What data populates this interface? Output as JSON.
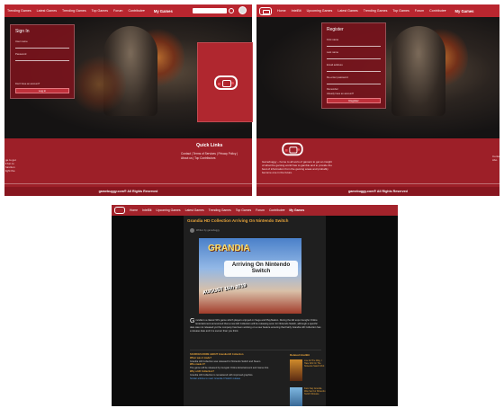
{
  "left_shot": {
    "nav": {
      "items": [
        "Trending Games",
        "Latest Games",
        "Trending Games",
        "Top Games",
        "Forum",
        "Contribute▾"
      ],
      "my_games": "My Games"
    },
    "signin": {
      "title": "Sign In",
      "username_label": "User name",
      "password_label": "Password",
      "forgot": "Don't have an account?",
      "button": "Log in"
    },
    "footer": {
      "quick_links": "Quick Links",
      "links_row1": "Contact | Terms of Services | Privacy Policy |",
      "links_row2": "About us | Top Contributors",
      "left_text": "ge to get\nll fun to\nfunction\nlight the",
      "copyright": "gamebuggy.com® All Rights Reserved"
    }
  },
  "right_shot": {
    "nav": {
      "items": [
        "Home",
        "IntelBit",
        "Upcoming Games",
        "Latest Games",
        "Trending Games",
        "Top Games",
        "Forum",
        "Contribute▾"
      ],
      "my_games": "My Games"
    },
    "register": {
      "title": "Register",
      "fields": [
        "First name",
        "Last name",
        "Email address",
        "Re-enter password"
      ],
      "checkbox": "Remember",
      "small": "Already have an account?",
      "button": "Register"
    },
    "footer": {
      "about": "Gamebuggy – home to all sorts of gamers to get an insight of what the gaming world has to gamble and to provide the best of information from the gaming areas and probably become one in the future.",
      "copyright": "gamebuggy.com® All Rights Reserved",
      "right_text": "Conta\nAbo"
    }
  },
  "bottom_shot": {
    "nav": {
      "items": [
        "Home",
        "IntelBit",
        "Upcoming Games",
        "Latest Games",
        "Trending Games",
        "Top Games",
        "Forum",
        "Contribute▾"
      ],
      "my_games": "My Games"
    },
    "article": {
      "title": "Grandia HD Collection Arriving On Nintendo Switch",
      "meta": "Written by gamebuggy",
      "image_title": "GRANDIA",
      "image_banner": "Arriving On Nintendo Switch",
      "image_date": "AUGUST 16th 2019",
      "drop_cap": "G",
      "body": "randia is a classic 90's game which players enjoyed on Sega and PlayStation. During the E3 expo Gungho Online Entertainment announced that a new HD Collection will be releasing soon for Nintendo Switch, although a specific date was not released yet the company has been working on a new feature ensuring that Fairly Grandia HD Collection has a release date and it is sooner than you think."
    },
    "related": {
      "heading": "SOURCES MORE ABOUT Grandia HD Collection",
      "lines": [
        "When was it made?",
        "Grandia HD Collection was released for Nintendo Switch and Steam.",
        "Who made it?",
        "The game will be released by GungHo Online Entertainment and Game Arts.",
        "Why a HD Collection?",
        "Grandia HD Collection is remastered with improved graphics.",
        "Similar articles to read: Grandia II Switch release"
      ]
    },
    "sidebar": {
      "heading": "Related IntelBit",
      "cards": [
        "Live All The Way, I Hate IGN On The Nintendo Switch Port",
        "Fans Say Grandia Was Set For Nintendo Switch Release"
      ]
    }
  }
}
